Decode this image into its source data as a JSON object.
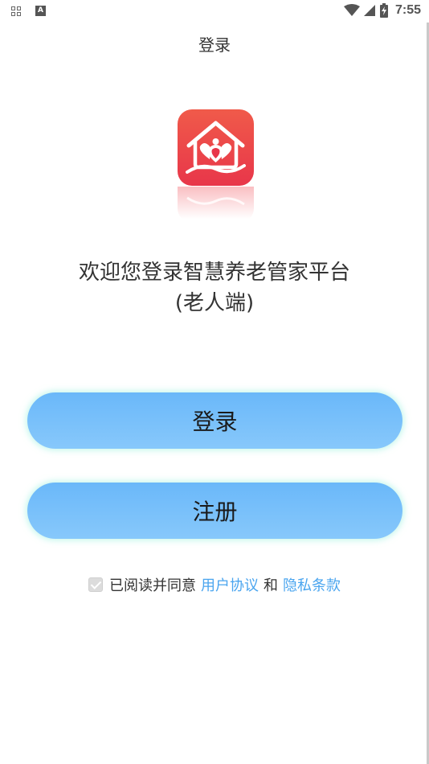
{
  "status_bar": {
    "time": "7:55",
    "left_icons": [
      "grid-icon",
      "a-icon"
    ],
    "right_icons": [
      "wifi-icon",
      "signal-icon",
      "battery-icon"
    ],
    "a_icon_glyph": "A"
  },
  "header": {
    "title": "登录"
  },
  "logo": {
    "icon": "house-hearts-logo",
    "colors": {
      "top": "#f05a4a",
      "bottom": "#e8364a"
    }
  },
  "welcome": {
    "line1": "欢迎您登录智慧养老管家平台",
    "line2": "(老人端)"
  },
  "buttons": {
    "login_label": "登录",
    "register_label": "注册",
    "color": "#6ab8f9"
  },
  "agreement": {
    "checked": true,
    "prefix": "已阅读并同意",
    "user_agreement": "用户协议",
    "and": "和",
    "privacy_policy": "隐私条款",
    "link_color": "#4aa5ef"
  }
}
